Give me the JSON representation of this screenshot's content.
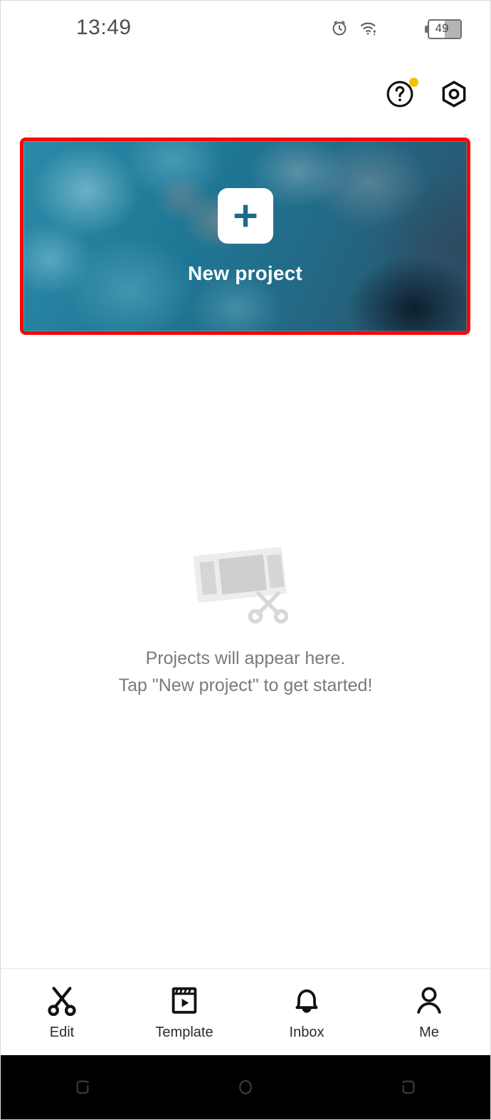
{
  "status_bar": {
    "time": "13:49",
    "battery_text": "49",
    "battery_percent": 49,
    "icons": [
      "alarm-icon",
      "wifi-icon",
      "battery-icon"
    ]
  },
  "top_actions": [
    {
      "name": "help-button",
      "icon": "help-circle-icon",
      "badge": true,
      "badge_color": "#f2c200"
    },
    {
      "name": "settings-button",
      "icon": "hex-nut-settings-icon",
      "badge": false
    }
  ],
  "banner": {
    "label": "New project",
    "icon": "plus-icon",
    "highlight_color": "#fa0505",
    "plus_color": "#1c6a8c",
    "tile_color": "#ffffff"
  },
  "empty_state": {
    "illustration": "film-strip-scissors-icon",
    "line1": "Projects will appear here.",
    "line2": "Tap \"New project\" to get started!"
  },
  "bottom_nav": {
    "items": [
      {
        "label": "Edit",
        "icon": "scissors-icon"
      },
      {
        "label": "Template",
        "icon": "clapperboard-play-icon"
      },
      {
        "label": "Inbox",
        "icon": "bell-icon"
      },
      {
        "label": "Me",
        "icon": "person-icon"
      }
    ]
  },
  "system_nav": {
    "buttons": [
      {
        "name": "recents-button",
        "icon": "recents-icon"
      },
      {
        "name": "home-button",
        "icon": "home-circle-icon"
      },
      {
        "name": "back-button",
        "icon": "back-icon"
      }
    ]
  }
}
